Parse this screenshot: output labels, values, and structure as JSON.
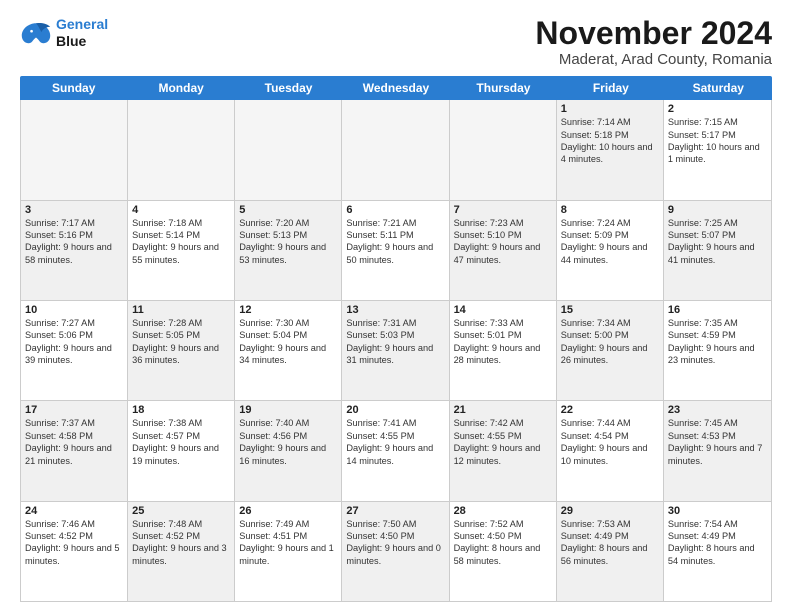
{
  "header": {
    "logo_line1": "General",
    "logo_line2": "Blue",
    "title": "November 2024",
    "subtitle": "Maderat, Arad County, Romania"
  },
  "weekdays": [
    "Sunday",
    "Monday",
    "Tuesday",
    "Wednesday",
    "Thursday",
    "Friday",
    "Saturday"
  ],
  "rows": [
    [
      {
        "day": "",
        "info": "",
        "empty": true
      },
      {
        "day": "",
        "info": "",
        "empty": true
      },
      {
        "day": "",
        "info": "",
        "empty": true
      },
      {
        "day": "",
        "info": "",
        "empty": true
      },
      {
        "day": "",
        "info": "",
        "empty": true
      },
      {
        "day": "1",
        "info": "Sunrise: 7:14 AM\nSunset: 5:18 PM\nDaylight: 10 hours and 4 minutes.",
        "shaded": true
      },
      {
        "day": "2",
        "info": "Sunrise: 7:15 AM\nSunset: 5:17 PM\nDaylight: 10 hours and 1 minute.",
        "shaded": false
      }
    ],
    [
      {
        "day": "3",
        "info": "Sunrise: 7:17 AM\nSunset: 5:16 PM\nDaylight: 9 hours and 58 minutes.",
        "shaded": true
      },
      {
        "day": "4",
        "info": "Sunrise: 7:18 AM\nSunset: 5:14 PM\nDaylight: 9 hours and 55 minutes.",
        "shaded": false
      },
      {
        "day": "5",
        "info": "Sunrise: 7:20 AM\nSunset: 5:13 PM\nDaylight: 9 hours and 53 minutes.",
        "shaded": true
      },
      {
        "day": "6",
        "info": "Sunrise: 7:21 AM\nSunset: 5:11 PM\nDaylight: 9 hours and 50 minutes.",
        "shaded": false
      },
      {
        "day": "7",
        "info": "Sunrise: 7:23 AM\nSunset: 5:10 PM\nDaylight: 9 hours and 47 minutes.",
        "shaded": true
      },
      {
        "day": "8",
        "info": "Sunrise: 7:24 AM\nSunset: 5:09 PM\nDaylight: 9 hours and 44 minutes.",
        "shaded": false
      },
      {
        "day": "9",
        "info": "Sunrise: 7:25 AM\nSunset: 5:07 PM\nDaylight: 9 hours and 41 minutes.",
        "shaded": true
      }
    ],
    [
      {
        "day": "10",
        "info": "Sunrise: 7:27 AM\nSunset: 5:06 PM\nDaylight: 9 hours and 39 minutes.",
        "shaded": false
      },
      {
        "day": "11",
        "info": "Sunrise: 7:28 AM\nSunset: 5:05 PM\nDaylight: 9 hours and 36 minutes.",
        "shaded": true
      },
      {
        "day": "12",
        "info": "Sunrise: 7:30 AM\nSunset: 5:04 PM\nDaylight: 9 hours and 34 minutes.",
        "shaded": false
      },
      {
        "day": "13",
        "info": "Sunrise: 7:31 AM\nSunset: 5:03 PM\nDaylight: 9 hours and 31 minutes.",
        "shaded": true
      },
      {
        "day": "14",
        "info": "Sunrise: 7:33 AM\nSunset: 5:01 PM\nDaylight: 9 hours and 28 minutes.",
        "shaded": false
      },
      {
        "day": "15",
        "info": "Sunrise: 7:34 AM\nSunset: 5:00 PM\nDaylight: 9 hours and 26 minutes.",
        "shaded": true
      },
      {
        "day": "16",
        "info": "Sunrise: 7:35 AM\nSunset: 4:59 PM\nDaylight: 9 hours and 23 minutes.",
        "shaded": false
      }
    ],
    [
      {
        "day": "17",
        "info": "Sunrise: 7:37 AM\nSunset: 4:58 PM\nDaylight: 9 hours and 21 minutes.",
        "shaded": true
      },
      {
        "day": "18",
        "info": "Sunrise: 7:38 AM\nSunset: 4:57 PM\nDaylight: 9 hours and 19 minutes.",
        "shaded": false
      },
      {
        "day": "19",
        "info": "Sunrise: 7:40 AM\nSunset: 4:56 PM\nDaylight: 9 hours and 16 minutes.",
        "shaded": true
      },
      {
        "day": "20",
        "info": "Sunrise: 7:41 AM\nSunset: 4:55 PM\nDaylight: 9 hours and 14 minutes.",
        "shaded": false
      },
      {
        "day": "21",
        "info": "Sunrise: 7:42 AM\nSunset: 4:55 PM\nDaylight: 9 hours and 12 minutes.",
        "shaded": true
      },
      {
        "day": "22",
        "info": "Sunrise: 7:44 AM\nSunset: 4:54 PM\nDaylight: 9 hours and 10 minutes.",
        "shaded": false
      },
      {
        "day": "23",
        "info": "Sunrise: 7:45 AM\nSunset: 4:53 PM\nDaylight: 9 hours and 7 minutes.",
        "shaded": true
      }
    ],
    [
      {
        "day": "24",
        "info": "Sunrise: 7:46 AM\nSunset: 4:52 PM\nDaylight: 9 hours and 5 minutes.",
        "shaded": false
      },
      {
        "day": "25",
        "info": "Sunrise: 7:48 AM\nSunset: 4:52 PM\nDaylight: 9 hours and 3 minutes.",
        "shaded": true
      },
      {
        "day": "26",
        "info": "Sunrise: 7:49 AM\nSunset: 4:51 PM\nDaylight: 9 hours and 1 minute.",
        "shaded": false
      },
      {
        "day": "27",
        "info": "Sunrise: 7:50 AM\nSunset: 4:50 PM\nDaylight: 9 hours and 0 minutes.",
        "shaded": true
      },
      {
        "day": "28",
        "info": "Sunrise: 7:52 AM\nSunset: 4:50 PM\nDaylight: 8 hours and 58 minutes.",
        "shaded": false
      },
      {
        "day": "29",
        "info": "Sunrise: 7:53 AM\nSunset: 4:49 PM\nDaylight: 8 hours and 56 minutes.",
        "shaded": true
      },
      {
        "day": "30",
        "info": "Sunrise: 7:54 AM\nSunset: 4:49 PM\nDaylight: 8 hours and 54 minutes.",
        "shaded": false
      }
    ]
  ]
}
